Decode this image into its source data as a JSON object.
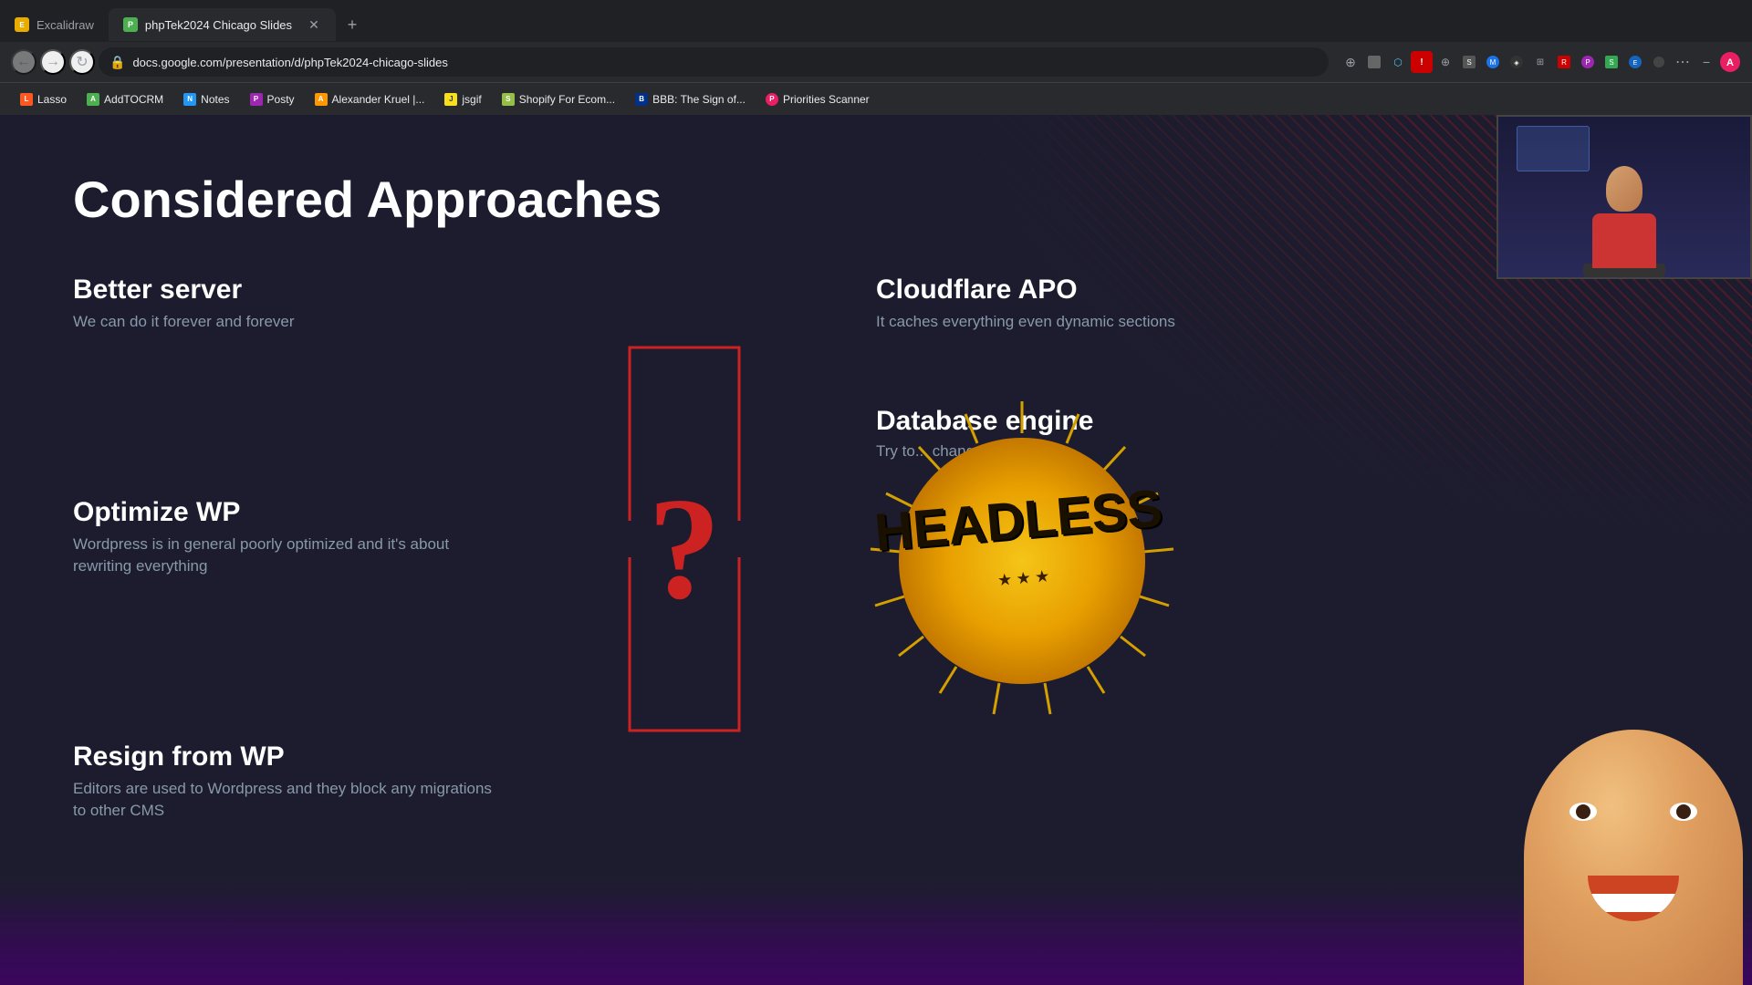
{
  "browser": {
    "tab_inactive": {
      "label": "Excalidraw",
      "icon": "E"
    },
    "tab_active": {
      "label": "phpTek2024 Chicago Slides",
      "icon": "P"
    },
    "address": "docs.google.com/presentation/d/phpTek2024-chicago-slides",
    "new_tab_label": "+"
  },
  "toolbar": {
    "back_label": "←",
    "forward_label": "→",
    "reload_label": "↺",
    "bookmark_label": "☆",
    "ext_label": "⚙"
  },
  "bookmarks": [
    {
      "id": "lasso",
      "label": "Lasso",
      "fav_class": "fav-lasso",
      "fav_char": "L"
    },
    {
      "id": "addtocrm",
      "label": "AddTOCRM",
      "fav_class": "fav-add",
      "fav_char": "A"
    },
    {
      "id": "notes",
      "label": "Notes",
      "fav_class": "fav-notes",
      "fav_char": "N"
    },
    {
      "id": "posty",
      "label": "Posty",
      "fav_class": "fav-posty",
      "fav_char": "P"
    },
    {
      "id": "alex",
      "label": "Alexander Kruel |...",
      "fav_class": "fav-alex",
      "fav_char": "A"
    },
    {
      "id": "jsgif",
      "label": "jsgif",
      "fav_class": "fav-js",
      "fav_char": "J"
    },
    {
      "id": "shopify",
      "label": "Shopify For Ecom...",
      "fav_class": "fav-shopify",
      "fav_char": "S"
    },
    {
      "id": "bbb",
      "label": "BBB: The Sign of...",
      "fav_class": "fav-bbb",
      "fav_char": "B"
    },
    {
      "id": "priorities",
      "label": "Priorities Scanner",
      "fav_class": "fav-prio",
      "fav_char": "P"
    }
  ],
  "slide": {
    "title": "Considered Approaches",
    "left_items": [
      {
        "id": "better-server",
        "title": "Better server",
        "description": "We can do it forever and forever"
      },
      {
        "id": "optimize-wp",
        "title": "Optimize WP",
        "description": "Wordpress is in general poorly optimized and it's about rewriting everything"
      },
      {
        "id": "resign-wp",
        "title": "Resign from WP",
        "description": "Editors are used to Wordpress and they block any migrations to other CMS"
      }
    ],
    "right_items": [
      {
        "id": "cloudflare",
        "title": "Cloudflare APO",
        "description": "It caches everything even dynamic sections"
      },
      {
        "id": "database",
        "title": "Database engine",
        "description": "Try to... changes"
      }
    ],
    "center_symbol": "?",
    "headless_label": "HEADLESS"
  }
}
